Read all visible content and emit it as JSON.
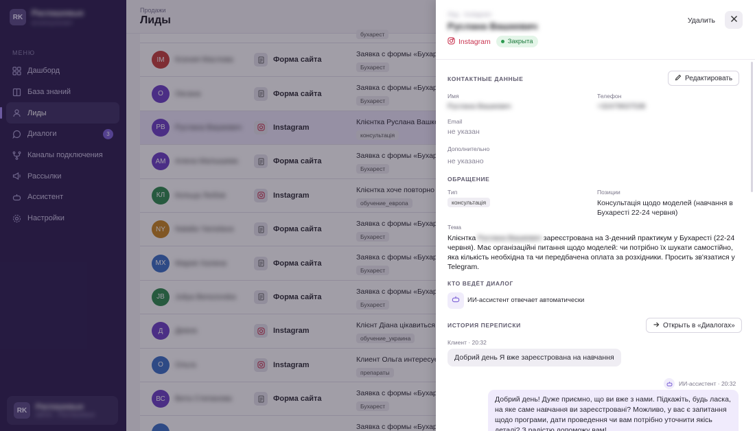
{
  "sidebar": {
    "brand": {
      "logo_text": "RK",
      "name": "Распашевые",
      "sub": "ai-консультант"
    },
    "menu_header": "МЕНЮ",
    "items": [
      {
        "label": "Дашборд",
        "icon": "dashboard-icon"
      },
      {
        "label": "База знаний",
        "icon": "book-icon"
      },
      {
        "label": "Лиды",
        "icon": "user-icon",
        "active": true
      },
      {
        "label": "Диалоги",
        "icon": "chat-icon",
        "badge": "3"
      },
      {
        "label": "Каналы подключения",
        "icon": "channels-icon"
      },
      {
        "label": "Рассылки",
        "icon": "megaphone-icon"
      },
      {
        "label": "Ассистент",
        "icon": "bot-icon"
      },
      {
        "label": "Настройки",
        "icon": "gear-icon"
      }
    ],
    "user": {
      "logo_text": "RK",
      "name": "Распашевые",
      "sub": "admin · Распашевые"
    }
  },
  "main": {
    "breadcrumb": "Продажи",
    "title": "Лиды",
    "leads": [
      {
        "initials": "",
        "color": "#bdb9c6",
        "name": "",
        "source": "",
        "subject": "",
        "tag": "бухарест"
      },
      {
        "initials": "IM",
        "color": "#c43f3a",
        "name": "Ксения Маслова",
        "source": "Форма сайта",
        "source_icon": "form-icon",
        "subject": "Заявка с формы «Бухарест»",
        "tag": "Бухарест"
      },
      {
        "initials": "О",
        "color": "#6b3fc4",
        "name": "Оксана",
        "source": "Форма сайта",
        "source_icon": "form-icon",
        "subject": "Заявка с формы «Бухарест»",
        "tag": "Бухарест"
      },
      {
        "initials": "РВ",
        "color": "#6b3fc4",
        "name": "Руслана Вашкевич",
        "source": "Instagram",
        "source_icon": "instagram-icon",
        "subject": "Клієнтка Руслана Вашкевич",
        "tag": "консультація",
        "selected": true
      },
      {
        "initials": "АМ",
        "color": "#6b3fc4",
        "name": "Алена Малышева",
        "source": "Форма сайта",
        "source_icon": "form-icon",
        "subject": "Заявка с формы «Бухарест»",
        "tag": "Бухарест"
      },
      {
        "initials": "КЛ",
        "color": "#2e8a4c",
        "name": "Кольца Любов",
        "source": "Instagram",
        "source_icon": "instagram-icon",
        "subject": "Клієнтка хоче повторно з",
        "tag": "обучение_европа"
      },
      {
        "initials": "NY",
        "color": "#c9861e",
        "name": "Natalia Yaroslava",
        "source": "Форма сайта",
        "source_icon": "form-icon",
        "subject": "Заявка с формы «Бухарест»",
        "tag": "Бухарест"
      },
      {
        "initials": "МХ",
        "color": "#3a6fc4",
        "name": "Мария Халина",
        "source": "Форма сайта",
        "source_icon": "form-icon",
        "subject": "Заявка с формы «Бухарест»",
        "tag": "Бухарест"
      },
      {
        "initials": "JB",
        "color": "#2e8a4c",
        "name": "Juliya Berezovska",
        "source": "Форма сайта",
        "source_icon": "form-icon",
        "subject": "Заявка с формы «Бухарест»",
        "tag": "Бухарест"
      },
      {
        "initials": "Д",
        "color": "#6b3fc4",
        "name": "Диана",
        "source": "Instagram",
        "source_icon": "instagram-icon",
        "subject": "Клієнт Діана цікавиться с",
        "tag": "обучение_украина"
      },
      {
        "initials": "О",
        "color": "#3a6fc4",
        "name": "Ольга",
        "source": "Instagram",
        "source_icon": "instagram-icon",
        "subject": "Клиент Ольга интересует",
        "tag": "препараты"
      },
      {
        "initials": "ВС",
        "color": "#6b3fc4",
        "name": "Вита Степанова",
        "source": "Форма сайта",
        "source_icon": "form-icon",
        "subject": "Заявка с формы «Бухарест»",
        "tag": "Бухарест"
      },
      {
        "initials": "",
        "color": "#3a6fc4",
        "name": "",
        "source": "",
        "source_icon": "form-icon",
        "subject": "Заявка с формы «Бухарест»",
        "tag": ""
      }
    ]
  },
  "panel": {
    "breadcrumb": "Лид · Instagram",
    "name": "Руслана Вашкевич",
    "source": "Instagram",
    "status": "Закрыта",
    "delete_label": "Удалить",
    "contacts": {
      "header": "КОНТАКТНЫЕ ДАННЫЕ",
      "edit_label": "Редактировать",
      "name_label": "Имя",
      "name_value": "Руслана Вашкевич",
      "phone_label": "Телефон",
      "phone_value": "+32479637538",
      "email_label": "Email",
      "email_value": "не указан",
      "extra_label": "Дополнительно",
      "extra_value": "не указано"
    },
    "request": {
      "header": "ОБРАЩЕНИЕ",
      "type_label": "Тип",
      "type_value": "консультація",
      "positions_label": "Позиции",
      "positions_value": "Консультація щодо моделей (навчання в Бухаресті 22-24 червня)",
      "topic_label": "Тема",
      "topic_prefix": "Клієнтка",
      "topic_name": "Руслана Вашкевич",
      "topic_rest": "зареєстрована на 3-денний практикум у Бухаресті (22-24 червня). Має організаційні питання щодо моделей: чи потрібно їх шукати самостійно, яка кількість необхідна та чи передбачена оплата за розхідники. Просить зв'язатися у Telegram."
    },
    "operator": {
      "header": "КТО ВЕДЁТ ДИАЛОГ",
      "text": "ИИ-ассистент отвечает автоматически"
    },
    "history": {
      "header": "ИСТОРИЯ ПЕРЕПИСКИ",
      "open_label": "Открыть в «Диалогах»",
      "messages": [
        {
          "meta": "Клиент · 20:32",
          "text": "Добрий день Я вже зареєстрована на навчання"
        },
        {
          "meta": "ИИ-ассистент · 20:32",
          "text": "Добрий день! Дуже приємно, що ви вже з нами. Підкажіть, будь ласка, на яке саме навчання ви зареєстровані? Можливо, у вас є запитання щодо програми, дати проведення чи вам потрібно уточнити якісь деталі? З радістю допоможу вам!"
        }
      ]
    }
  }
}
